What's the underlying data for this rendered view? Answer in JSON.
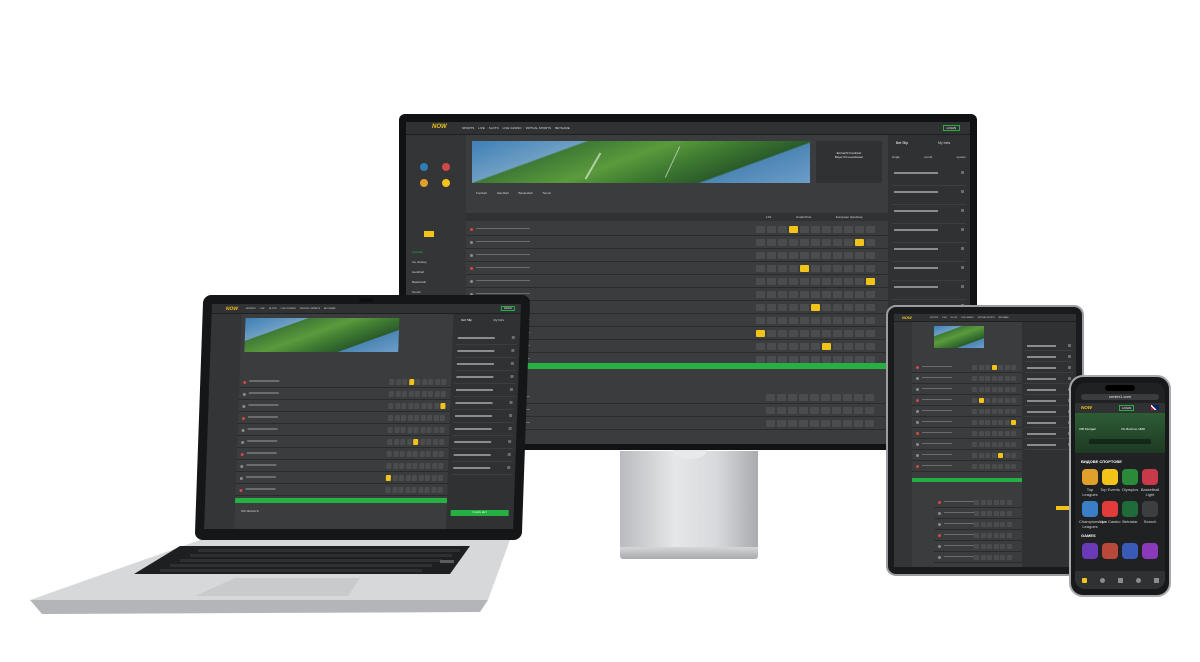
{
  "brand": {
    "logo": "NOW",
    "accent": "#f2c318",
    "green": "#27b042",
    "bg": "#2b2c2e"
  },
  "monitor": {
    "nav": [
      "SPORTS",
      "LIVE",
      "SLOTS",
      "LIVE CASINO",
      "VIRTUAL SPORTS",
      "BETGAME"
    ],
    "login_button": "LOGIN",
    "match": {
      "team1": "Eintracht Frankfurt",
      "team2": "Bayer 04 Leverkusen"
    },
    "bet_slip_tabs": [
      "Bet Slip",
      "My bets"
    ],
    "slip_subtabs": [
      "single",
      "combi",
      "system"
    ],
    "sport_tabs": [
      "Football",
      "Handball",
      "Basketball",
      "Tennis"
    ],
    "sidebar": [
      "Football",
      "Ice Hockey",
      "Handball",
      "Basketball",
      "Tennis",
      "American Football"
    ],
    "market_heads": [
      "1X2",
      "Under/Over",
      "European Handicap"
    ]
  },
  "laptop": {
    "nav": [
      "SPORTS",
      "LIVE",
      "SLOTS",
      "LIVE CASINO",
      "VIRTUAL SPORTS",
      "BETGAME"
    ],
    "login_button": "LOGIN",
    "bet_slip_tabs": [
      "Bet Slip",
      "My bets"
    ],
    "place_bet": "PLACE BET",
    "top_results": "TOP RESULTS"
  },
  "tablet": {
    "nav": [
      "SPORTS",
      "LIVE",
      "SLOTS",
      "LIVE CASINO",
      "VIRTUAL SPORTS",
      "BETGAME"
    ]
  },
  "phone": {
    "url": "center1.com",
    "login_button": "LOGIN",
    "score_team1": "VfB Stuttgart",
    "score_team2": "VfL Bochum 1848",
    "section_title": "ВИДОВЕ СПОРТОВЕ",
    "tiles": [
      "Top Leagues",
      "Top Events",
      "Olympics",
      "Basketball Light",
      "Championships Leagues",
      "Live Casino",
      "Betradar",
      "Search"
    ],
    "games_title": "GAMES"
  }
}
